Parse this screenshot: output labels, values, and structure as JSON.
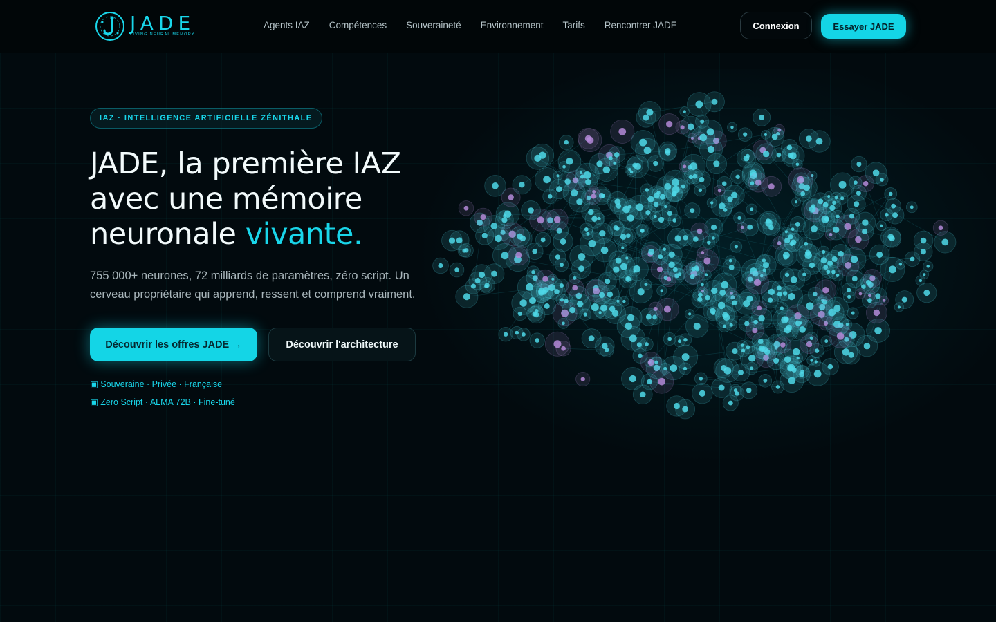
{
  "brand": {
    "name": "JADE",
    "tagline": "LIVING NEURAL MEMORY",
    "accent": "#14d5e6",
    "logo_icon": "neural-j-icon"
  },
  "nav": {
    "items": [
      {
        "label": "Agents IAZ"
      },
      {
        "label": "Compétences"
      },
      {
        "label": "Souveraineté"
      },
      {
        "label": "Environnement"
      },
      {
        "label": "Tarifs"
      },
      {
        "label": "Rencontrer JADE"
      }
    ],
    "login_label": "Connexion",
    "try_label": "Essayer JADE"
  },
  "hero": {
    "eyebrow": "IAZ · INTELLIGENCE ARTIFICIELLE ZÉNITHALE",
    "title_line1": "JADE, la première IAZ",
    "title_line2": "avec une mémoire",
    "title_line3_start": "neuronale ",
    "title_line3_accent": "vivante.",
    "lead": "755 000+ neurones, 72 milliards de paramètres, zéro script. Un cerveau propriétaire qui apprend, ressent et comprend vraiment.",
    "cta_primary": "Découvrir les offres JADE →",
    "cta_secondary": "Découvrir l'architecture",
    "features": [
      "▣ Souveraine · Privée · Française",
      "▣ Zero Script · ALMA 72B · Fine-tuné"
    ],
    "visual": "neural-network-cloud",
    "node_colors": [
      "#4fd8e8",
      "#b48ad8"
    ]
  }
}
